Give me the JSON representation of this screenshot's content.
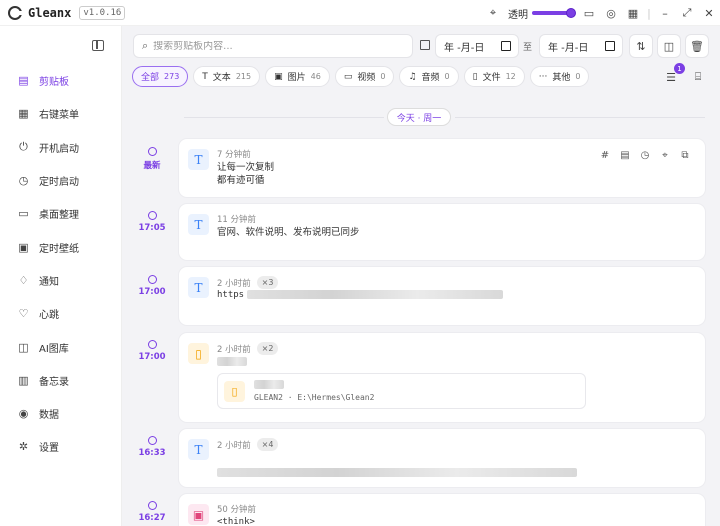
{
  "app": {
    "name": "Gleanx",
    "version": "v1.0.16"
  },
  "titlebar": {
    "opacity_label": "透明",
    "opacity_value": 1.0,
    "accent": "#7b3fe4"
  },
  "sidebar": {
    "items": [
      {
        "label": "剪贴板",
        "icon": "clipboard-icon",
        "active": true
      },
      {
        "label": "右键菜单",
        "icon": "menu-icon"
      },
      {
        "label": "开机启动",
        "icon": "power-icon"
      },
      {
        "label": "定时启动",
        "icon": "clock-icon"
      },
      {
        "label": "桌面整理",
        "icon": "desktop-icon"
      },
      {
        "label": "定时壁纸",
        "icon": "wallpaper-icon"
      },
      {
        "label": "通知",
        "icon": "bell-icon"
      },
      {
        "label": "心跳",
        "icon": "heart-icon"
      },
      {
        "label": "AI图库",
        "icon": "gallery-icon"
      },
      {
        "label": "备忘录",
        "icon": "memo-icon"
      },
      {
        "label": "数据",
        "icon": "database-icon"
      },
      {
        "label": "设置",
        "icon": "gear-icon"
      }
    ]
  },
  "toolbar": {
    "search_placeholder": "搜索剪贴板内容...",
    "date_from": "年 -月-日",
    "date_to": "年 -月-日",
    "to_label": "至"
  },
  "filters": [
    {
      "label": "全部",
      "count": "273",
      "icon": "",
      "active": true
    },
    {
      "label": "文本",
      "count": "215",
      "icon": "T"
    },
    {
      "label": "图片",
      "count": "46",
      "icon": "▣"
    },
    {
      "label": "视频",
      "count": "0",
      "icon": "▭"
    },
    {
      "label": "音频",
      "count": "0",
      "icon": "♫"
    },
    {
      "label": "文件",
      "count": "12",
      "icon": "▯"
    },
    {
      "label": "其他",
      "count": "0",
      "icon": "···"
    }
  ],
  "notification_badge": "1",
  "date_group": "今天 · 周一",
  "entries": [
    {
      "time": "最新",
      "type": "text",
      "ago": "7 分钟前",
      "lines": [
        "让每一次复制",
        "都有迹可循"
      ]
    },
    {
      "time": "17:05",
      "type": "text",
      "ago": "11 分钟前",
      "lines": [
        "官网、软件说明、发布说明已同步"
      ]
    },
    {
      "time": "17:00",
      "type": "text",
      "ago": "2 小时前",
      "mult": "×3",
      "prefix": "https"
    },
    {
      "time": "17:00",
      "type": "file",
      "ago": "2 小时前",
      "mult": "×2",
      "path": "GLEAN2 · E:\\Hermes\\Glean2"
    },
    {
      "time": "16:33",
      "type": "text",
      "ago": "2 小时前",
      "mult": "×4"
    },
    {
      "time": "16:27",
      "type": "image",
      "ago": "50 分钟前",
      "lines": [
        "<think>"
      ]
    }
  ]
}
